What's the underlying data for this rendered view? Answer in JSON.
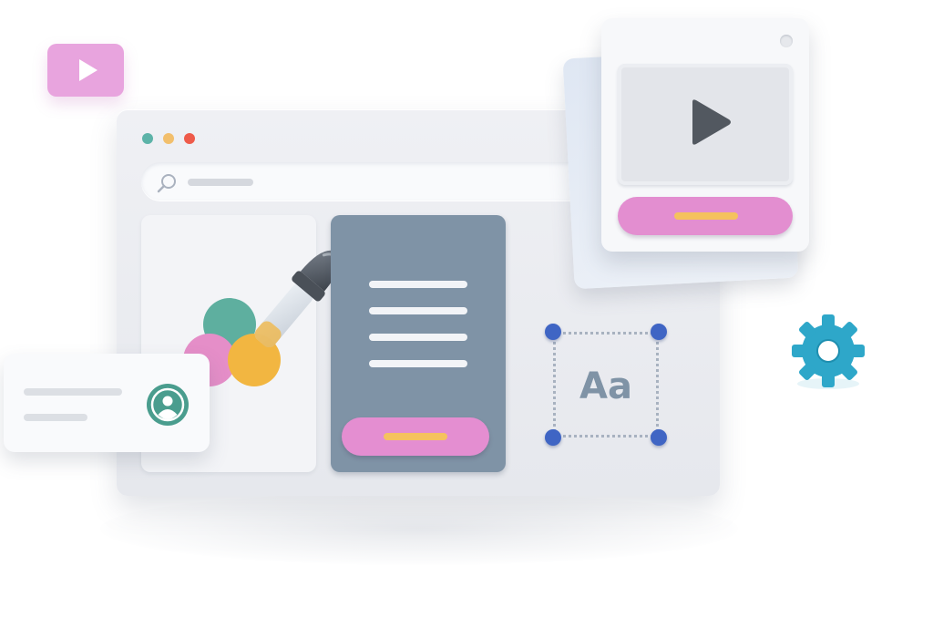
{
  "colors": {
    "traffic_teal": "#5cb3a8",
    "traffic_yellow": "#f2bf6c",
    "traffic_red": "#ee5b4a",
    "swatch_teal": "#5eaf9f",
    "swatch_pink": "#e58ec8",
    "swatch_yellow": "#f2b641",
    "panel_slate": "#7f93a6",
    "button_pink": "#e48ed1",
    "button_bar_yellow": "#f5c25e",
    "selection_handle_blue": "#3f65c4",
    "gear_teal": "#2ea7c9",
    "avatar_teal": "#4a9d8e"
  },
  "icons": {
    "search": "search-icon",
    "eyedropper": "eyedropper-icon",
    "avatar": "user-avatar-icon",
    "play": "play-icon",
    "gear": "gear-icon"
  },
  "typography_sample": {
    "text": "Aa"
  }
}
